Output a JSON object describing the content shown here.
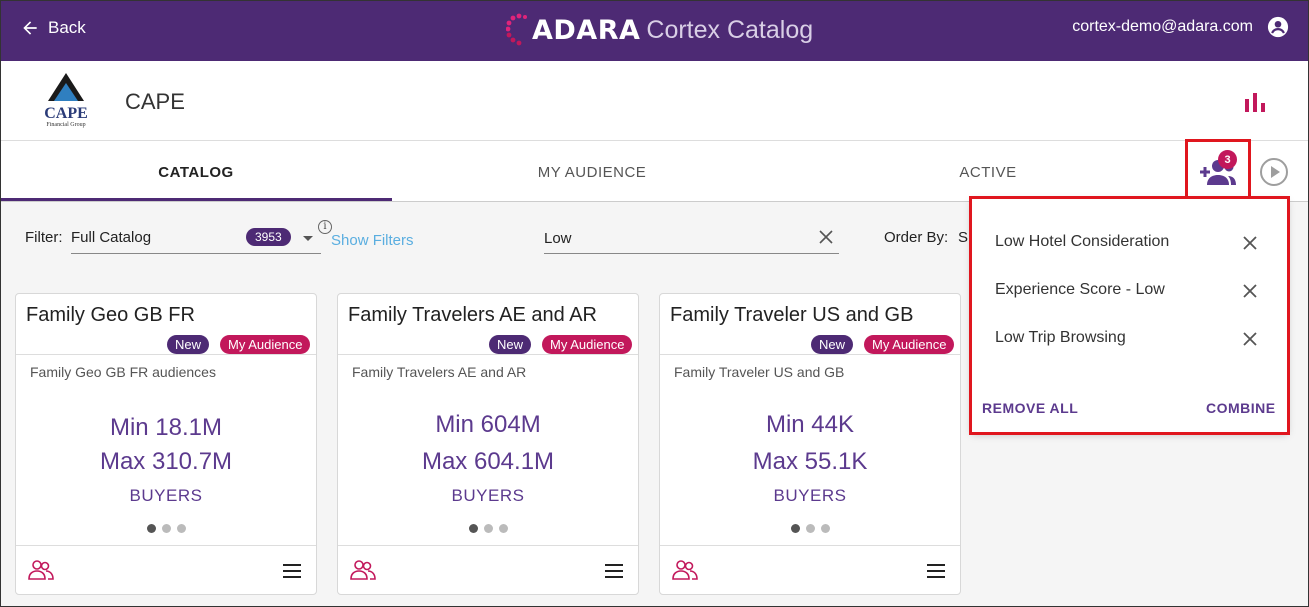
{
  "header": {
    "back_label": "Back",
    "brand_name": "ADARA",
    "brand_product": "Cortex Catalog",
    "user_email": "cortex-demo@adara.com"
  },
  "company": {
    "name": "CAPE",
    "logo_text": "CAPE",
    "logo_subtext": "Financial Group"
  },
  "tabs": [
    {
      "label": "CATALOG",
      "active": true
    },
    {
      "label": "MY AUDIENCE",
      "active": false
    },
    {
      "label": "ACTIVE",
      "active": false
    }
  ],
  "selection": {
    "count": "3"
  },
  "filter": {
    "label": "Filter:",
    "value": "Full Catalog",
    "count": "3953",
    "info_glyph": "i",
    "show_filters": "Show Filters",
    "search_value": "Low",
    "order_label": "Order By:",
    "order_value": "S"
  },
  "cards": [
    {
      "title": "Family Geo GB FR",
      "badge_new": "New",
      "badge_my": "My Audience",
      "subtitle": "Family Geo GB FR audiences",
      "min": "Min 18.1M",
      "max": "Max 310.7M",
      "unit": "BUYERS",
      "active_dot": 0
    },
    {
      "title": "Family Travelers AE and AR",
      "badge_new": "New",
      "badge_my": "My Audience",
      "subtitle": "Family Travelers AE and AR",
      "min": "Min 604M",
      "max": "Max 604.1M",
      "unit": "BUYERS",
      "active_dot": 0
    },
    {
      "title": "Family Traveler US and GB",
      "badge_new": "New",
      "badge_my": "My Audience",
      "subtitle": "Family Traveler US and GB",
      "min": "Min 44K",
      "max": "Max 55.1K",
      "unit": "BUYERS",
      "active_dot": 0
    }
  ],
  "popup": {
    "items": [
      "Low Hotel Consideration",
      "Experience Score - Low",
      "Low Trip Browsing"
    ],
    "remove_all": "REMOVE ALL",
    "combine": "COMBINE"
  },
  "colors": {
    "header_bg": "#4d2a74",
    "accent_purple": "#5c3a8e",
    "accent_magenta": "#c2185b",
    "highlight_red": "#e0161e",
    "link_blue": "#5aaee0"
  }
}
